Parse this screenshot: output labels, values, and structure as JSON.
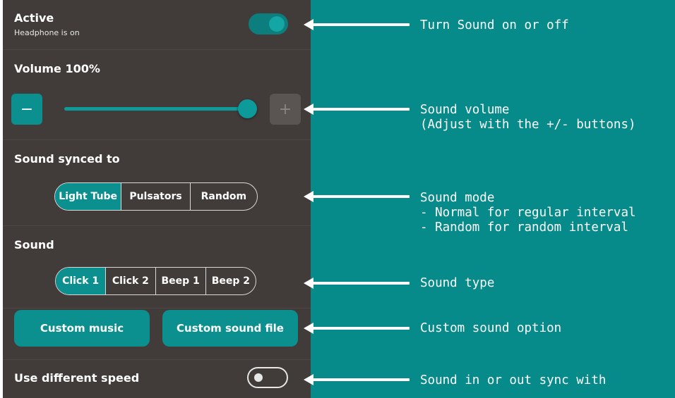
{
  "active": {
    "title": "Active",
    "subtitle": "Headphone is on",
    "toggle_on": true
  },
  "volume": {
    "label": "Volume 100%",
    "minus": "−",
    "plus": "+",
    "level": 1.0
  },
  "synced": {
    "label": "Sound synced to",
    "options": [
      "Light Tube",
      "Pulsators",
      "Random"
    ],
    "selected": 0
  },
  "sound": {
    "label": "Sound",
    "options": [
      "Click 1",
      "Click 2",
      "Beep 1",
      "Beep 2"
    ],
    "selected": 0
  },
  "buttons": {
    "custom_music": "Custom music",
    "custom_sound_file": "Custom sound file"
  },
  "speed": {
    "label": "Use different speed",
    "toggle_on": false
  },
  "annotations": {
    "toggle": "Turn Sound on or off",
    "volume": "Sound volume\n(Adjust with the +/- buttons)",
    "mode": "Sound mode\n- Normal for regular interval\n- Random for random interval",
    "type": "Sound type",
    "custom": "Custom sound option",
    "speed": "Sound in or out sync with"
  },
  "colors": {
    "panel": "#413c3a",
    "accent": "#0c8f8f",
    "background": "#068a8a"
  }
}
